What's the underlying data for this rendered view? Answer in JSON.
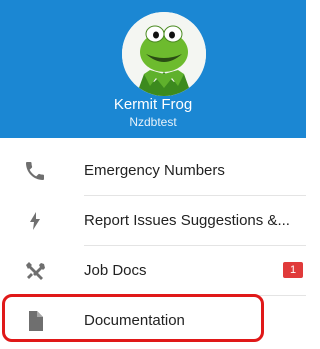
{
  "profile": {
    "name": "Kermit Frog",
    "subtitle": "Nzdbtest",
    "avatar_icon": "kermit-avatar"
  },
  "menu": {
    "items": [
      {
        "label": "Emergency Numbers",
        "icon": "phone-icon"
      },
      {
        "label": "Report Issues Suggestions &...",
        "icon": "bolt-icon"
      },
      {
        "label": "Job Docs",
        "icon": "tools-icon",
        "badge": "1"
      },
      {
        "label": "Documentation",
        "icon": "document-icon"
      }
    ]
  },
  "colors": {
    "header_bg": "#1b87d3",
    "badge_bg": "#e03a3a",
    "highlight_border": "#e01818"
  }
}
